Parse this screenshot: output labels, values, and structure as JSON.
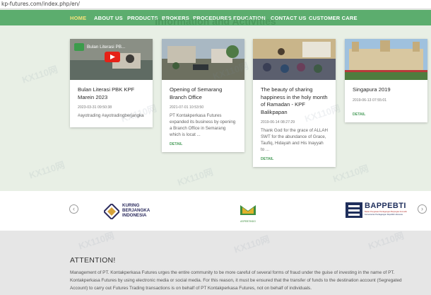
{
  "browser": {
    "url": "kp-futures.com/index.php/en/"
  },
  "nav": {
    "items": [
      {
        "label": "HOME",
        "active": true
      },
      {
        "label": "ABOUT US"
      },
      {
        "label": "PRODUCTS"
      },
      {
        "label": "BROKERS"
      },
      {
        "label": "PROCEDURES"
      },
      {
        "label": "EDUCATION"
      },
      {
        "label": "CONTACT US"
      },
      {
        "label": "CUSTOMER CARE"
      }
    ],
    "section_title": "Information and Activities"
  },
  "cards": [
    {
      "thumb_caption": "Bulan Literasi PB...",
      "title": "Bulan Literasi PBK KPF Marein 2023",
      "date": "2023-03-31 09:50:38",
      "body": "#ayotrading #ayotradingberjangka",
      "link": ""
    },
    {
      "title": "Opening of Semarang Branch Office",
      "date": "2021-07-01 10:53:50",
      "body": "PT Kontakperkasa Futures expanded its business by opening a Branch Office in Semarang which is locat ...",
      "link": "DETAIL"
    },
    {
      "title": "The beauty of sharing happiness in the holy month of Ramadan - KPF Balikpapan",
      "date": "2019-06-14 08:27:29",
      "body": "Thank God for the grace of ALLAH SWT for the abundance of Grace, Taufiq, Hidayah and His Inayyah to ...",
      "link": "DETAIL"
    },
    {
      "title": "Singapura 2019",
      "date": "2019-06-13 07:55:01",
      "body": "",
      "link": "DETAIL"
    }
  ],
  "partners": {
    "items": [
      {
        "name": "KURING BERJANGKA INDONESIA",
        "line1": "KURING",
        "line2": "BERJANGKA",
        "line3": "INDONESIA"
      },
      {
        "name": "ASPEBTINDO",
        "caption": "ASPEBTINDO"
      },
      {
        "name": "BAPPEBTI",
        "title": "BAPPEBTI",
        "subtitle": "Badan Pengawas Perdagangan Berjangka Komoditi",
        "subtitle2": "Kementerian Perdagangan Republik Indonesia"
      }
    ],
    "prev_arrow": "‹",
    "next_arrow": "›"
  },
  "attention": {
    "title": "ATTENTION!",
    "text": "Management of PT. Kontakperkasa Futures urges the entire community to be more careful of several forms of fraud under the guise of investing in the name of PT. Kontakperkasa Futures by using electronic media or social media. For this reason, it must be ensured that the transfer of funds to the destination account (Segregated Account) to carry out Futures Trading transactions is on behalf of PT Kontakperkasa Futures, not on behalf of individuals."
  },
  "watermark": "KX110网",
  "colors": {
    "nav_bg": "#5cad6e",
    "accent": "#4a9d5b",
    "active_nav": "#f6e27a"
  }
}
